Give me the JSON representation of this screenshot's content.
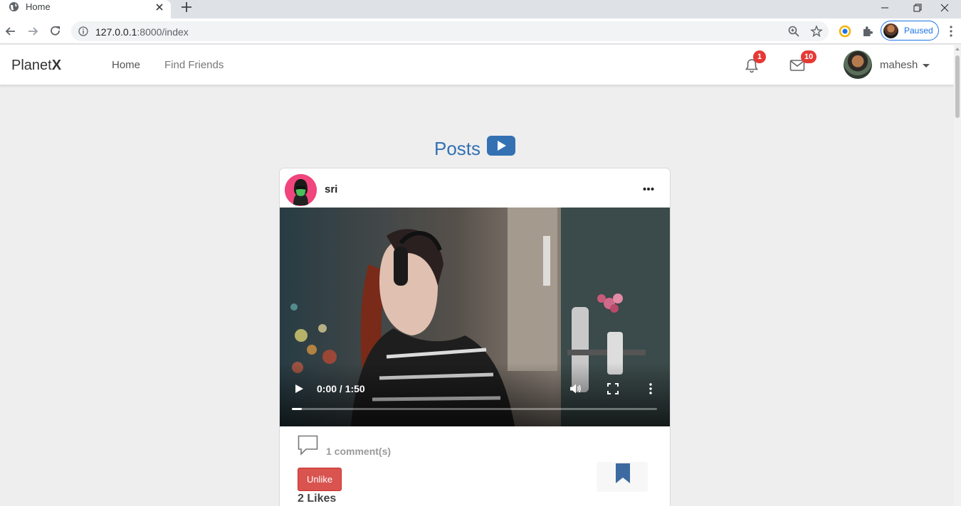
{
  "browser": {
    "tab_title": "Home",
    "url_host": "127.0.0.1",
    "url_rest": ":8000/index",
    "profile_status": "Paused"
  },
  "navbar": {
    "brand_prefix": "Planet",
    "brand_suffix": "X",
    "links": [
      {
        "label": "Home",
        "color": "#555555"
      },
      {
        "label": "Find Friends",
        "color": "#777777"
      }
    ],
    "notifications_count": "1",
    "messages_count": "10",
    "username": "mahesh"
  },
  "main": {
    "heading": "Posts"
  },
  "post": {
    "author": "sri",
    "video": {
      "time": "0:00 / 1:50",
      "progress_fraction": 0.0
    },
    "comments_text": "1 comment(s)",
    "like_button_label": "Unlike",
    "likes_text": "2 Likes"
  },
  "colors": {
    "accent": "#3371b3",
    "danger": "#d9534f",
    "badge": "#e53935"
  },
  "icons": [
    "globe-icon",
    "close-icon",
    "plus-icon",
    "back-icon",
    "forward-icon",
    "reload-icon",
    "info-icon",
    "zoom-icon",
    "star-icon",
    "extension-icon",
    "puzzle-icon",
    "kebab-icon",
    "bell-icon",
    "envelope-icon",
    "play-icon",
    "volume-icon",
    "fullscreen-icon",
    "more-icon",
    "comment-icon",
    "bookmark-icon"
  ]
}
